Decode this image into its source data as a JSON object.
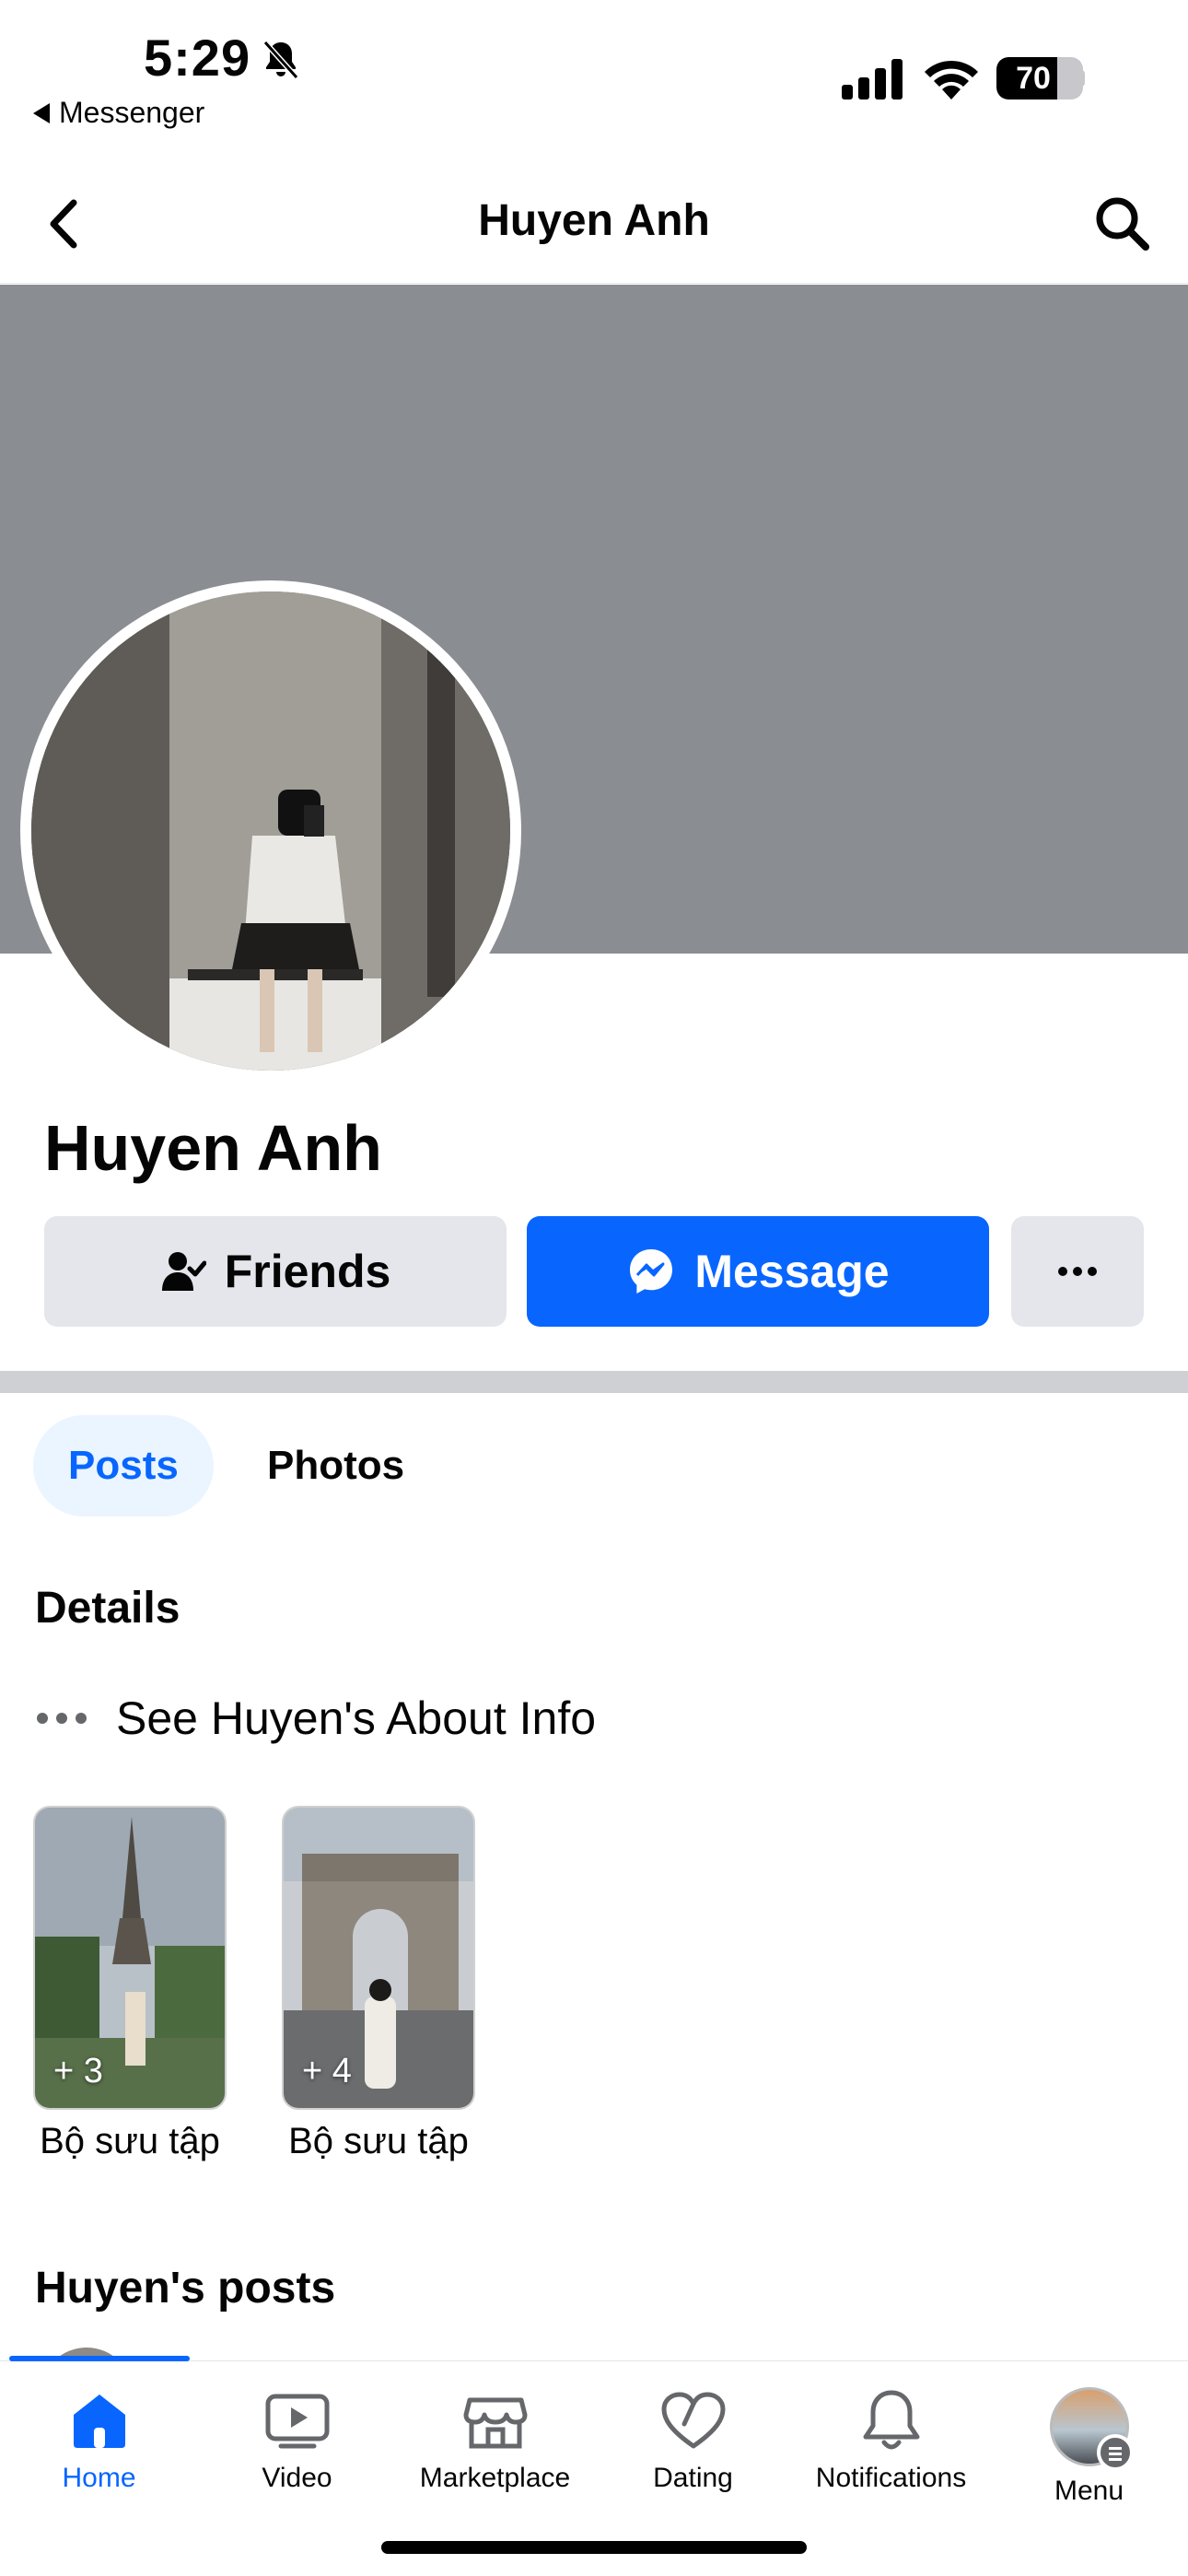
{
  "status_bar": {
    "time": "5:29",
    "back_app_label": "Messenger",
    "battery_level": "70",
    "battery_fraction": 0.7,
    "icons": [
      "bell-slash-icon",
      "cellular-signal-icon",
      "wifi-icon",
      "battery-icon"
    ]
  },
  "header": {
    "title": "Huyen Anh",
    "icons": [
      "back-chevron-icon",
      "search-icon"
    ]
  },
  "profile": {
    "name": "Huyen Anh",
    "cover_color": "#8a8d91"
  },
  "actions": {
    "friends_label": "Friends",
    "message_label": "Message",
    "more_icon": "more-dots-icon",
    "message_color": "#0866ff"
  },
  "tabs": [
    {
      "label": "Posts",
      "active": true
    },
    {
      "label": "Photos",
      "active": false
    }
  ],
  "details": {
    "title": "Details",
    "about_text": "See Huyen's About Info"
  },
  "collections": [
    {
      "count": "+ 3",
      "label": "Bộ sưu tập"
    },
    {
      "count": "+ 4",
      "label": "Bộ sưu tập"
    }
  ],
  "posts_section": {
    "title": "Huyen's posts"
  },
  "tabbar": {
    "items": [
      {
        "label": "Home",
        "icon": "home-icon",
        "active": true
      },
      {
        "label": "Video",
        "icon": "video-icon",
        "active": false
      },
      {
        "label": "Marketplace",
        "icon": "marketplace-icon",
        "active": false
      },
      {
        "label": "Dating",
        "icon": "dating-heart-icon",
        "active": false
      },
      {
        "label": "Notifications",
        "icon": "bell-icon",
        "active": false
      },
      {
        "label": "Menu",
        "icon": "menu-avatar-icon",
        "active": false
      }
    ],
    "accent": "#0866ff"
  }
}
